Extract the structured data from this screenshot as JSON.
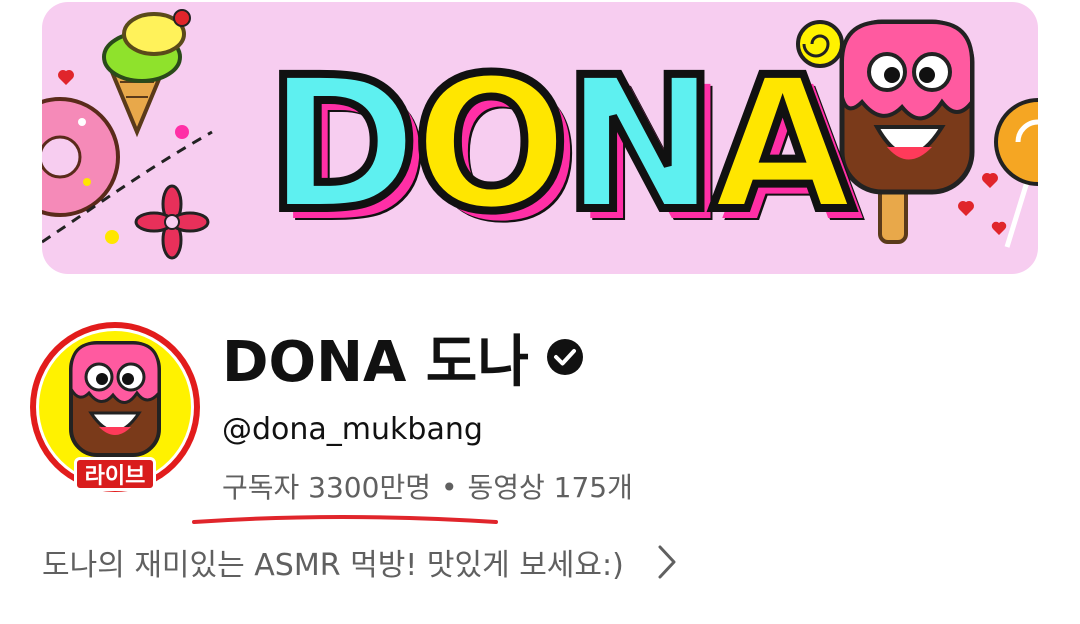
{
  "banner": {
    "title": "DONA"
  },
  "channel": {
    "name": "DONA 도나",
    "handle": "@dona_mukbang",
    "subscribers": "구독자 3300만명",
    "separator": "•",
    "videos": "동영상 175개",
    "description": "도나의 재미있는 ASMR 먹방! 맛있게 보세요:)",
    "live_badge": "라이브",
    "verified": true
  },
  "icons": {
    "verified": "verified-check-icon",
    "chevron": "chevron-right-icon"
  },
  "colors": {
    "banner_bg": "#f7cdf0",
    "live_red": "#d91c1c",
    "avatar_bg": "#fff200",
    "annotation_red": "#e0252b"
  }
}
